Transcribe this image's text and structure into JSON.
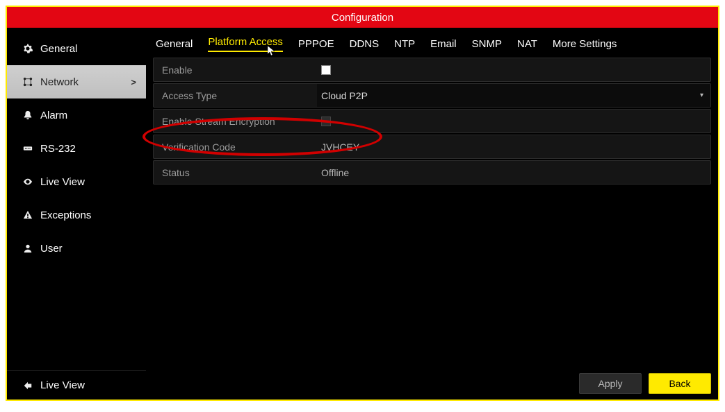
{
  "title": "Configuration",
  "sidebar": {
    "items": [
      {
        "label": "General"
      },
      {
        "label": "Network"
      },
      {
        "label": "Alarm"
      },
      {
        "label": "RS-232"
      },
      {
        "label": "Live View"
      },
      {
        "label": "Exceptions"
      },
      {
        "label": "User"
      }
    ],
    "footer": {
      "label": "Live View"
    }
  },
  "tabs": [
    {
      "label": "General"
    },
    {
      "label": "Platform Access"
    },
    {
      "label": "PPPOE"
    },
    {
      "label": "DDNS"
    },
    {
      "label": "NTP"
    },
    {
      "label": "Email"
    },
    {
      "label": "SNMP"
    },
    {
      "label": "NAT"
    },
    {
      "label": "More Settings"
    }
  ],
  "form": {
    "enable_label": "Enable",
    "access_type_label": "Access Type",
    "access_type_value": "Cloud P2P",
    "stream_enc_label": "Enable Stream Encryption",
    "verification_label": "Verification Code",
    "verification_value": "JVHCEY",
    "status_label": "Status",
    "status_value": "Offline"
  },
  "buttons": {
    "apply": "Apply",
    "back": "Back"
  }
}
